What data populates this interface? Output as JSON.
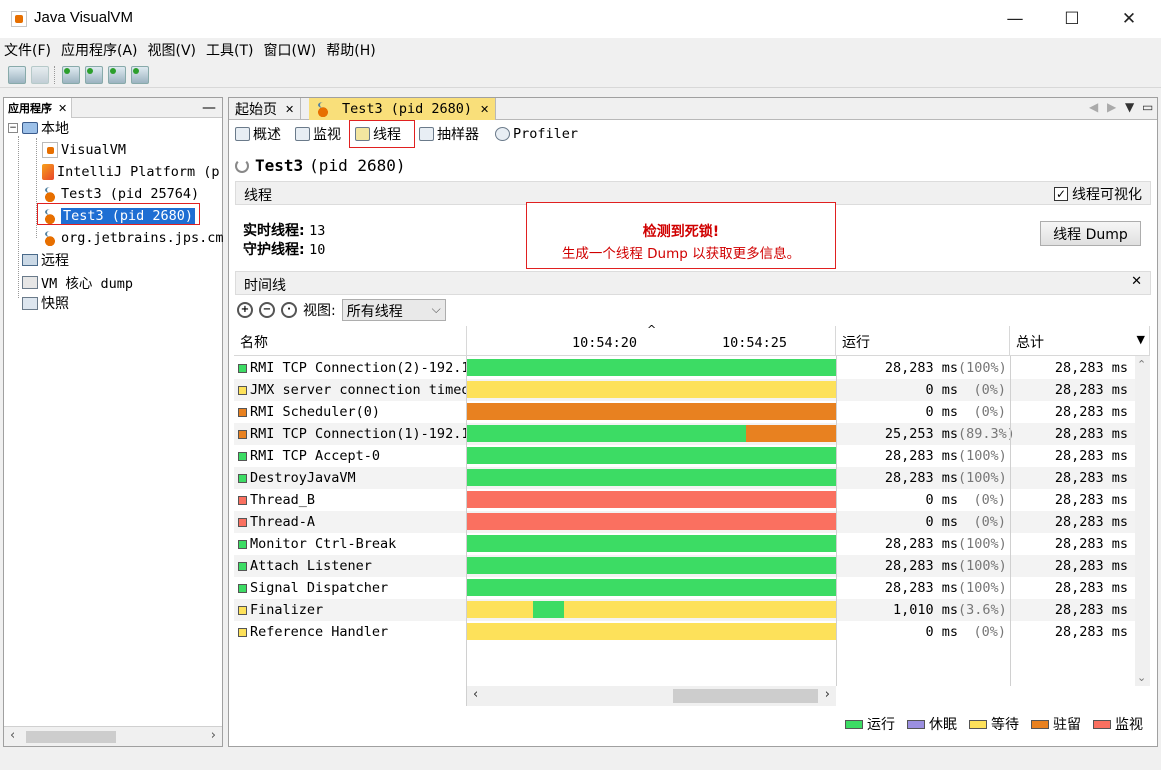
{
  "window": {
    "title": "Java VisualVM",
    "controls": [
      "—",
      "☐",
      "✕"
    ]
  },
  "menu": [
    "文件(F)",
    "应用程序(A)",
    "视图(V)",
    "工具(T)",
    "窗口(W)",
    "帮助(H)"
  ],
  "left_panel": {
    "tab_label": "应用程序",
    "tree": {
      "local_label": "本地",
      "local_items": [
        "VisualVM",
        "IntelliJ Platform (p",
        "Test3 (pid 25764)",
        "Test3 (pid 2680)",
        "org.jetbrains.jps.cm"
      ],
      "remote_label": "远程",
      "dump_label": "VM 核心 dump",
      "snapshot_label": "快照"
    }
  },
  "doc_tabs": [
    "起始页",
    "Test3 (pid 2680)"
  ],
  "sub_tabs": [
    "概述",
    "监视",
    "线程",
    "抽样器",
    "Profiler"
  ],
  "process_title_name": "Test3",
  "process_title_pid": "(pid 2680)",
  "threads_section": {
    "label": "线程",
    "visualize_label": "线程可视化",
    "visualize_checked": true,
    "live_label": "实时线程:",
    "live_value": "13",
    "daemon_label": "守护线程:",
    "daemon_value": "10",
    "deadlock_title": "检测到死锁!",
    "deadlock_message": "生成一个线程 Dump 以获取更多信息。",
    "dump_button": "线程 Dump"
  },
  "timeline_section": {
    "label": "时间线",
    "view_label": "视图:",
    "view_value": "所有线程"
  },
  "table": {
    "headers": {
      "name": "名称",
      "time1": "10:54:20",
      "time2": "10:54:25",
      "run": "运行",
      "total": "总计"
    },
    "rows": [
      {
        "name": "RMI TCP Connection(2)-192.1",
        "color": "#3cdc64",
        "run": "28,283 ms",
        "pct": "(100%)",
        "total": "28,283 ms",
        "segments": [
          {
            "state": "running",
            "from": 0,
            "to": 1
          }
        ]
      },
      {
        "name": "JMX server connection timeo",
        "color": "#fde15a",
        "run": "0 ms",
        "pct": "(0%)",
        "total": "28,283 ms",
        "segments": [
          {
            "state": "wait",
            "from": 0,
            "to": 1
          }
        ]
      },
      {
        "name": "RMI Scheduler(0)",
        "color": "#e88120",
        "run": "0 ms",
        "pct": "(0%)",
        "total": "28,283 ms",
        "segments": [
          {
            "state": "park",
            "from": 0,
            "to": 1
          }
        ]
      },
      {
        "name": "RMI TCP Connection(1)-192.1",
        "color": "#e88120",
        "run": "25,253 ms",
        "pct": "(89.3%)",
        "total": "28,283 ms",
        "segments": [
          {
            "state": "running",
            "from": 0,
            "to": 0.755
          },
          {
            "state": "park",
            "from": 0.755,
            "to": 1
          }
        ]
      },
      {
        "name": "RMI TCP Accept-0",
        "color": "#3cdc64",
        "run": "28,283 ms",
        "pct": "(100%)",
        "total": "28,283 ms",
        "segments": [
          {
            "state": "running",
            "from": 0,
            "to": 1
          }
        ]
      },
      {
        "name": "DestroyJavaVM",
        "color": "#3cdc64",
        "run": "28,283 ms",
        "pct": "(100%)",
        "total": "28,283 ms",
        "segments": [
          {
            "state": "running",
            "from": 0,
            "to": 1
          }
        ]
      },
      {
        "name": "Thread_B",
        "color": "#fa7060",
        "run": "0 ms",
        "pct": "(0%)",
        "total": "28,283 ms",
        "segments": [
          {
            "state": "monitor",
            "from": 0,
            "to": 1
          }
        ]
      },
      {
        "name": "Thread-A",
        "color": "#fa7060",
        "run": "0 ms",
        "pct": "(0%)",
        "total": "28,283 ms",
        "segments": [
          {
            "state": "monitor",
            "from": 0,
            "to": 1
          }
        ]
      },
      {
        "name": "Monitor Ctrl-Break",
        "color": "#3cdc64",
        "run": "28,283 ms",
        "pct": "(100%)",
        "total": "28,283 ms",
        "segments": [
          {
            "state": "running",
            "from": 0,
            "to": 1
          }
        ]
      },
      {
        "name": "Attach Listener",
        "color": "#3cdc64",
        "run": "28,283 ms",
        "pct": "(100%)",
        "total": "28,283 ms",
        "segments": [
          {
            "state": "running",
            "from": 0,
            "to": 1
          }
        ]
      },
      {
        "name": "Signal Dispatcher",
        "color": "#3cdc64",
        "run": "28,283 ms",
        "pct": "(100%)",
        "total": "28,283 ms",
        "segments": [
          {
            "state": "running",
            "from": 0,
            "to": 1
          }
        ]
      },
      {
        "name": "Finalizer",
        "color": "#fde15a",
        "run": "1,010 ms",
        "pct": "(3.6%)",
        "total": "28,283 ms",
        "segments": [
          {
            "state": "wait",
            "from": 0,
            "to": 0.18
          },
          {
            "state": "running",
            "from": 0.18,
            "to": 0.263
          },
          {
            "state": "wait",
            "from": 0.263,
            "to": 1
          }
        ]
      },
      {
        "name": "Reference Handler",
        "color": "#fde15a",
        "run": "0 ms",
        "pct": "(0%)",
        "total": "28,283 ms",
        "segments": [
          {
            "state": "wait",
            "from": 0,
            "to": 1
          }
        ]
      }
    ]
  },
  "state_colors": {
    "running": "#3cdc64",
    "sleeping": "#9b8fe0",
    "wait": "#fde15a",
    "park": "#e88120",
    "monitor": "#fa7060"
  },
  "legend": [
    {
      "state": "running",
      "label": "运行"
    },
    {
      "state": "sleeping",
      "label": "休眠"
    },
    {
      "state": "wait",
      "label": "等待"
    },
    {
      "state": "park",
      "label": "驻留"
    },
    {
      "state": "monitor",
      "label": "监视"
    }
  ]
}
